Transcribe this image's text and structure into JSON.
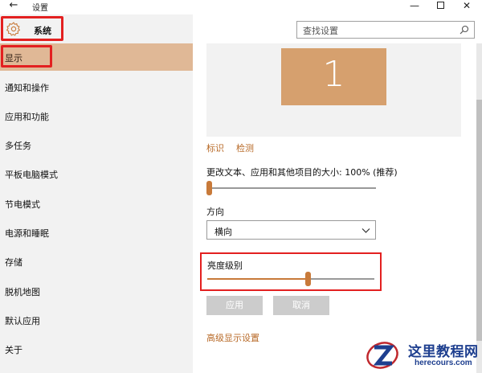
{
  "window": {
    "title": "设置"
  },
  "sidebar": {
    "header_label": "系统",
    "items": [
      {
        "label": "显示",
        "selected": true
      },
      {
        "label": "通知和操作"
      },
      {
        "label": "应用和功能"
      },
      {
        "label": "多任务"
      },
      {
        "label": "平板电脑模式"
      },
      {
        "label": "节电模式"
      },
      {
        "label": "电源和睡眠"
      },
      {
        "label": "存储"
      },
      {
        "label": "脱机地图"
      },
      {
        "label": "默认应用"
      },
      {
        "label": "关于"
      }
    ]
  },
  "search": {
    "placeholder": "查找设置"
  },
  "display": {
    "monitor_number": "1",
    "identify_link": "标识",
    "detect_link": "检测",
    "scale_label": "更改文本、应用和其他项目的大小: 100% (推荐)",
    "scale_value_percent": 0,
    "orientation_label": "方向",
    "orientation_value": "横向",
    "brightness_label": "亮度级别",
    "brightness_value_percent": 60,
    "apply_button": "应用",
    "cancel_button": "取消",
    "advanced_link": "高级显示设置"
  },
  "watermark": {
    "name": "这里教程网",
    "url": "herecours.com"
  },
  "colors": {
    "accent": "#c87a3a",
    "selected_nav": "#e0b896",
    "monitor": "#d6a06e",
    "highlight_box": "#e32020"
  }
}
